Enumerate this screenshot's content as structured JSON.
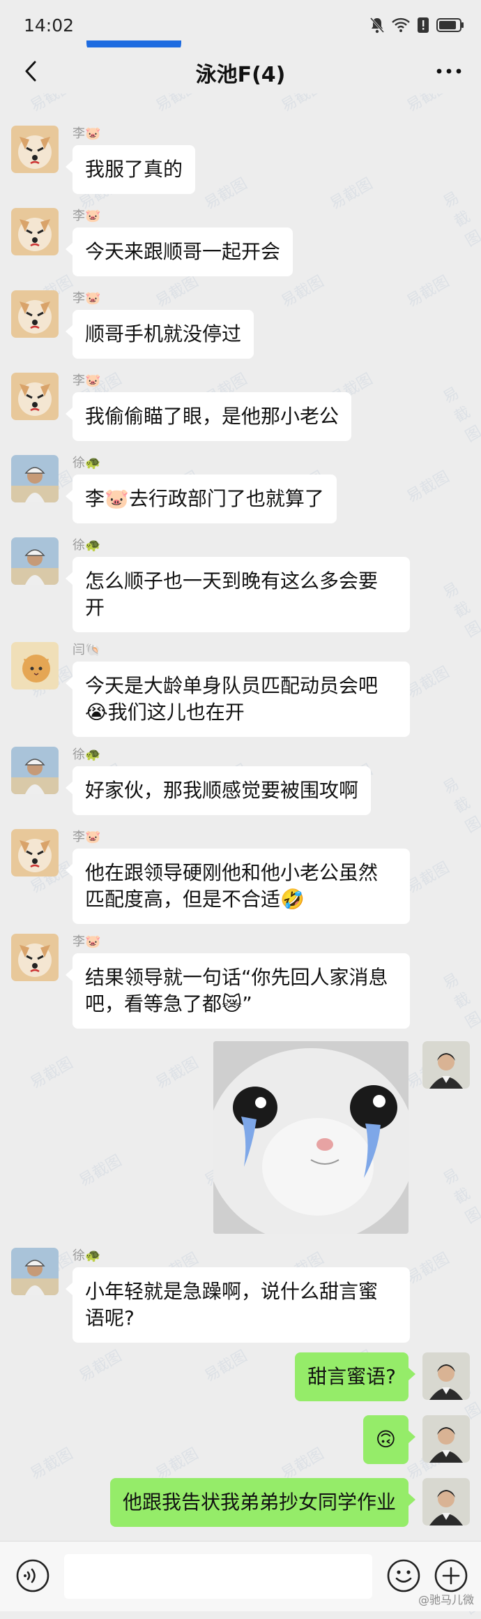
{
  "status_bar": {
    "time": "14:02"
  },
  "header": {
    "title": "泳池F(4)",
    "more": "•••"
  },
  "messages": [
    {
      "dir": "in",
      "sender": "李🐷",
      "text": "我服了真的",
      "avatar": "dog"
    },
    {
      "dir": "in",
      "sender": "李🐷",
      "text": "今天来跟顺哥一起开会",
      "avatar": "dog"
    },
    {
      "dir": "in",
      "sender": "李🐷",
      "text": "顺哥手机就没停过",
      "avatar": "dog"
    },
    {
      "dir": "in",
      "sender": "李🐷",
      "text": "我偷偷瞄了眼，是他那小老公",
      "avatar": "dog"
    },
    {
      "dir": "in",
      "sender": "徐🐢",
      "text": "李🐷去行政部门了也就算了",
      "avatar": "rider"
    },
    {
      "dir": "in",
      "sender": "徐🐢",
      "text": "怎么顺子也一天到晚有这么多会要\n开",
      "avatar": "rider"
    },
    {
      "dir": "in",
      "sender": "闫🐚",
      "text": "今天是大龄单身队员匹配动员会吧\n😭我们这儿也在开",
      "avatar": "cat"
    },
    {
      "dir": "in",
      "sender": "徐🐢",
      "text": "好家伙，那我顺感觉要被围攻啊",
      "avatar": "rider"
    },
    {
      "dir": "in",
      "sender": "李🐷",
      "text": "他在跟领导硬刚他和他小老公虽然\n匹配度高，但是不合适🤣",
      "avatar": "dog"
    },
    {
      "dir": "in",
      "sender": "李🐷",
      "text": "结果领导就一句话“你先回人家消息\n吧，看等急了都😿”",
      "avatar": "dog"
    },
    {
      "dir": "out",
      "type": "sticker",
      "avatar": "man"
    },
    {
      "dir": "in",
      "sender": "徐🐢",
      "text": "小年轻就是急躁啊，说什么甜言蜜\n语呢?",
      "avatar": "rider"
    },
    {
      "dir": "out",
      "text": "甜言蜜语?",
      "avatar": "man"
    },
    {
      "dir": "out",
      "text": "🙃",
      "avatar": "man"
    },
    {
      "dir": "out",
      "text": "他跟我告状我弟弟抄女同学作业",
      "avatar": "man"
    }
  ],
  "watermark": {
    "text": "易截图",
    "credit": "@驰马儿微"
  },
  "colors": {
    "out_bubble": "#95ec69",
    "in_bubble": "#ffffff",
    "bg": "#ededed"
  }
}
